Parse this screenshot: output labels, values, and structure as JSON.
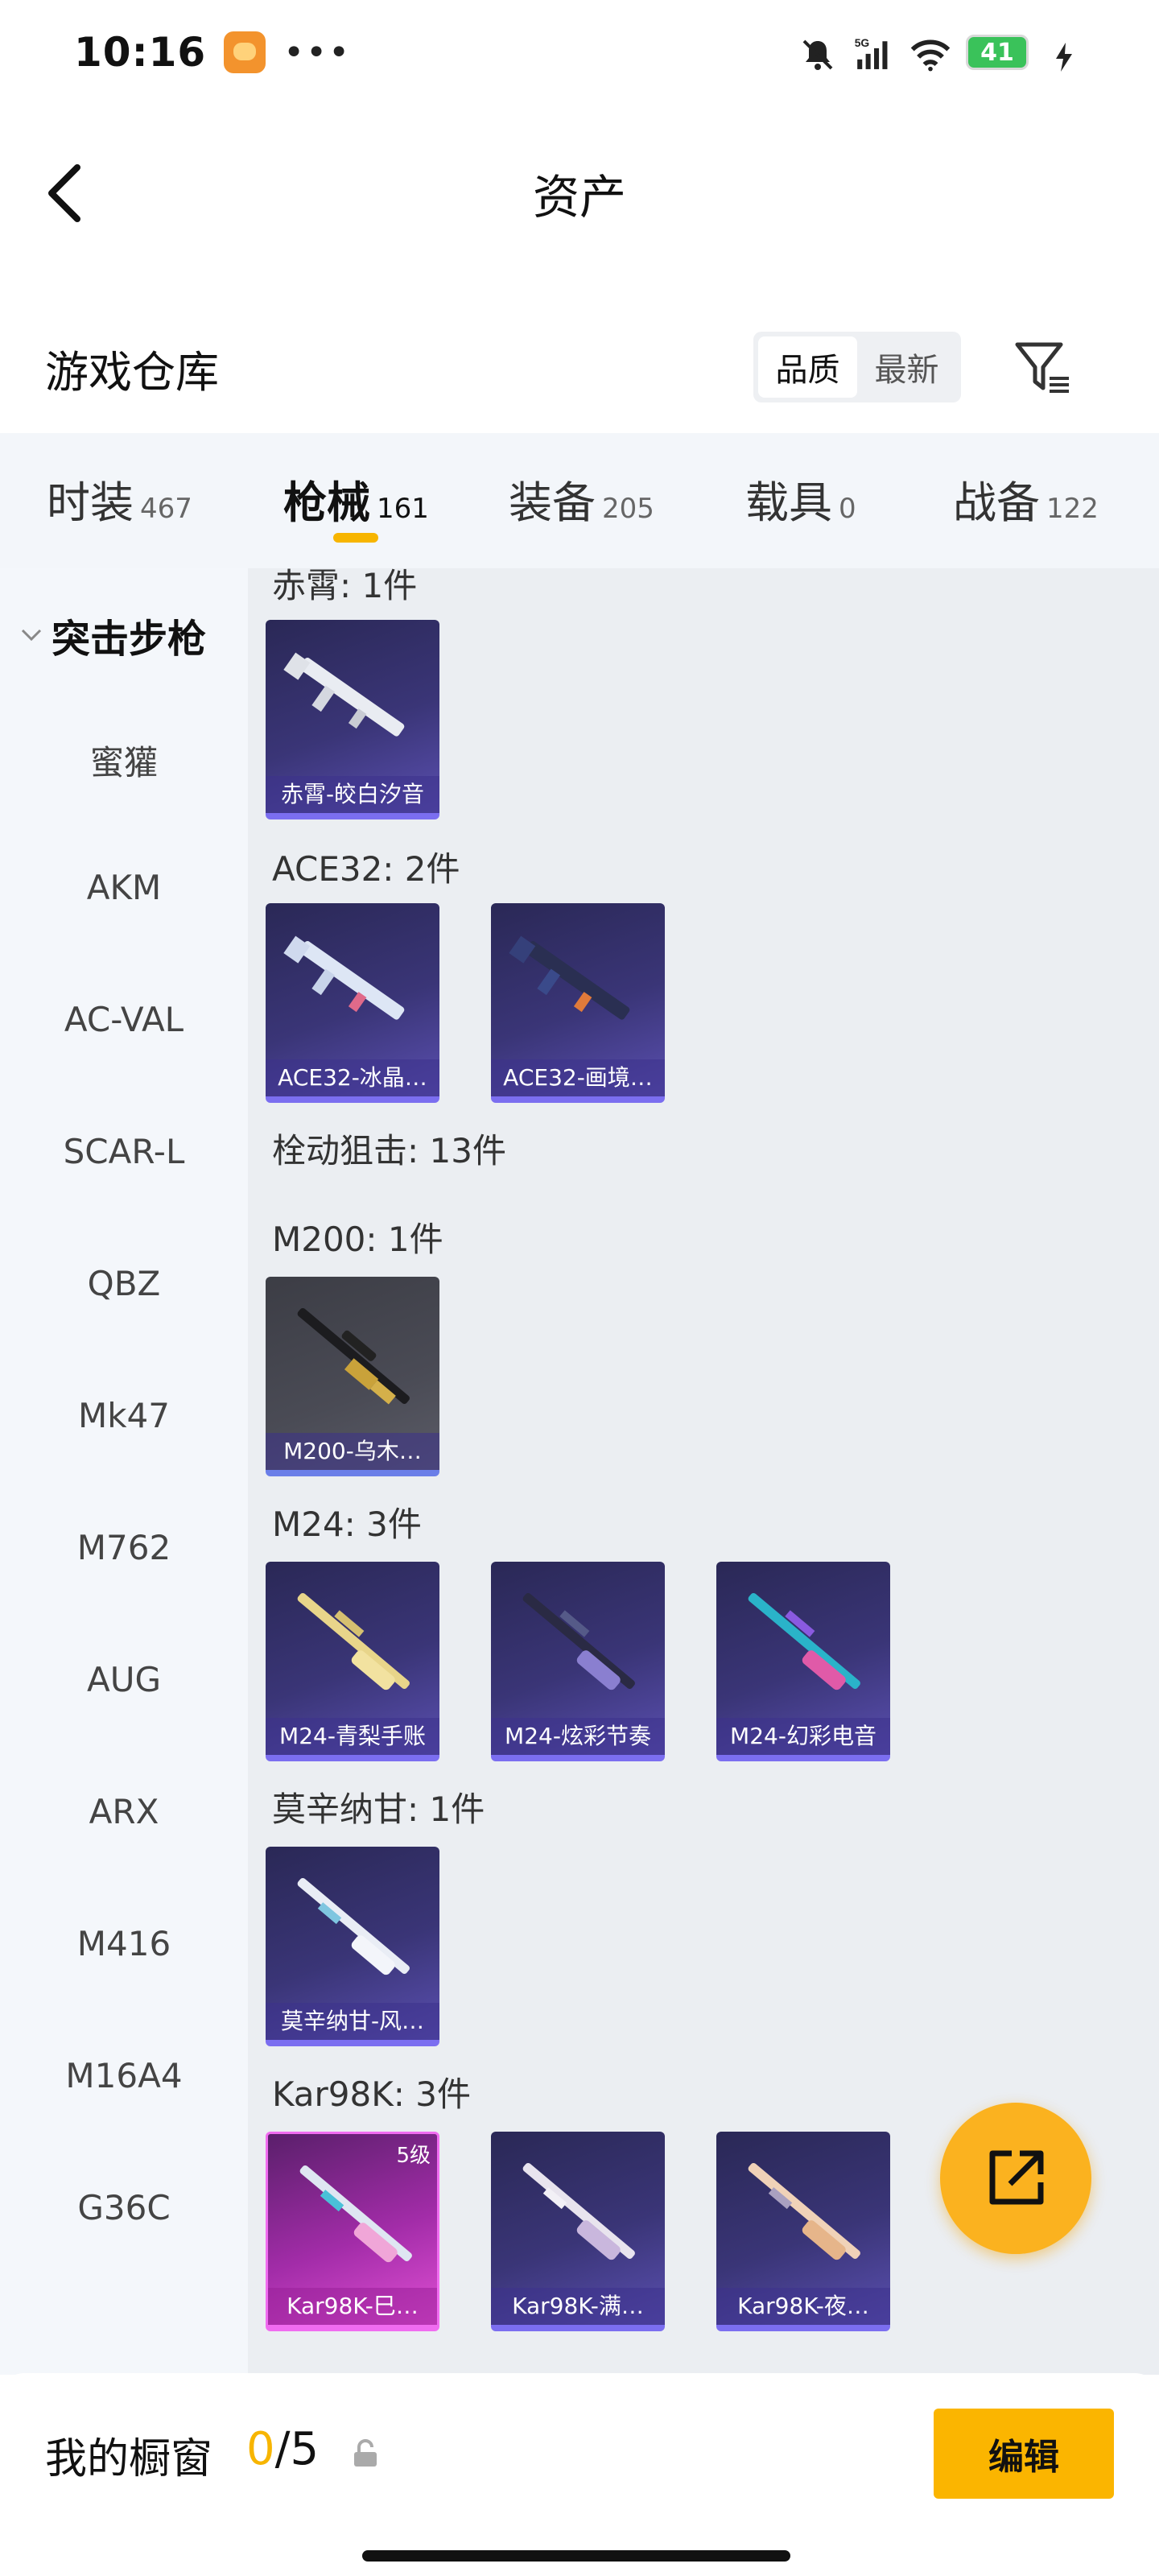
{
  "status": {
    "time": "10:16",
    "dots": "•••",
    "battery": "41",
    "network": "5G"
  },
  "header": {
    "title": "资产"
  },
  "warehouse": {
    "title": "游戏仓库",
    "sort_quality": "品质",
    "sort_newest": "最新"
  },
  "categories": [
    {
      "label": "时装",
      "count": "467"
    },
    {
      "label": "枪械",
      "count": "161"
    },
    {
      "label": "装备",
      "count": "205"
    },
    {
      "label": "载具",
      "count": "0"
    },
    {
      "label": "战备",
      "count": "122"
    }
  ],
  "sidebar": {
    "group": "突击步枪",
    "items": [
      "蜜獾",
      "AKM",
      "AC-VAL",
      "SCAR-L",
      "QBZ",
      "Mk47",
      "M762",
      "AUG",
      "ARX",
      "M416",
      "M16A4",
      "G36C"
    ]
  },
  "groups": {
    "chixiao": {
      "title": "赤霄: 1件",
      "cards": [
        "赤霄-皎白汐音"
      ]
    },
    "ace32": {
      "title": "ACE32: 2件",
      "cards": [
        "ACE32-冰晶…",
        "ACE32-画境…"
      ]
    },
    "bolt": {
      "title": "栓动狙击: 13件"
    },
    "m200": {
      "title": "M200: 1件",
      "cards": [
        "M200-乌木…"
      ]
    },
    "m24": {
      "title": "M24: 3件",
      "cards": [
        "M24-青梨手账",
        "M24-炫彩节奏",
        "M24-幻彩电音"
      ]
    },
    "mosin": {
      "title": "莫辛纳甘: 1件",
      "cards": [
        "莫辛纳甘-风…"
      ]
    },
    "kar98": {
      "title": "Kar98K: 3件",
      "cards": [
        "Kar98K-巳…",
        "Kar98K-满…",
        "Kar98K-夜…"
      ],
      "level": "5级"
    }
  },
  "bottom": {
    "showcase_label": "我的橱窗",
    "current": "0",
    "total": "/5",
    "edit": "编辑"
  },
  "colors": {
    "accent": "#f7b500",
    "card_purple": "#3a3577",
    "card_pink": "#a22ca8"
  }
}
